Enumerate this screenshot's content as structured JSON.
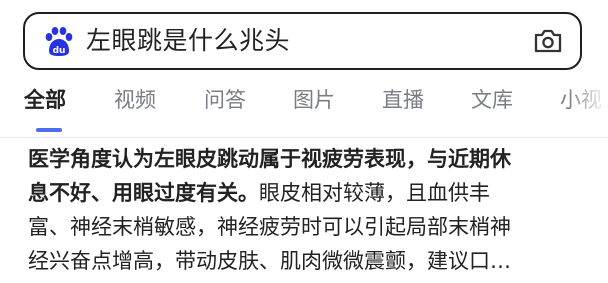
{
  "search": {
    "query": "左眼跳是什么兆头"
  },
  "tabs": [
    {
      "label": "全部"
    },
    {
      "label": "视频"
    },
    {
      "label": "问答"
    },
    {
      "label": "图片"
    },
    {
      "label": "直播"
    },
    {
      "label": "文库"
    },
    {
      "label": "小视"
    }
  ],
  "result": {
    "line1_bold": "医学角度认为左眼皮跳动属于视疲劳表现，与近期休",
    "line2_bold": "息不好、用眼过度有关。",
    "line2_rest": "眼皮相对较薄，且血供丰",
    "line3": "富、神经末梢敏感，神经疲劳时可以引起局部末梢神",
    "line4": "经兴奋点增高，带动皮肤、肌肉微微震颤，建议口…"
  },
  "colors": {
    "accent": "#4e6ef2",
    "baidu_logo": "#2932e1",
    "text": "#222222",
    "muted": "#7a7d85"
  },
  "icons": {
    "logo": "baidu-paw-logo",
    "camera": "camera-icon"
  }
}
